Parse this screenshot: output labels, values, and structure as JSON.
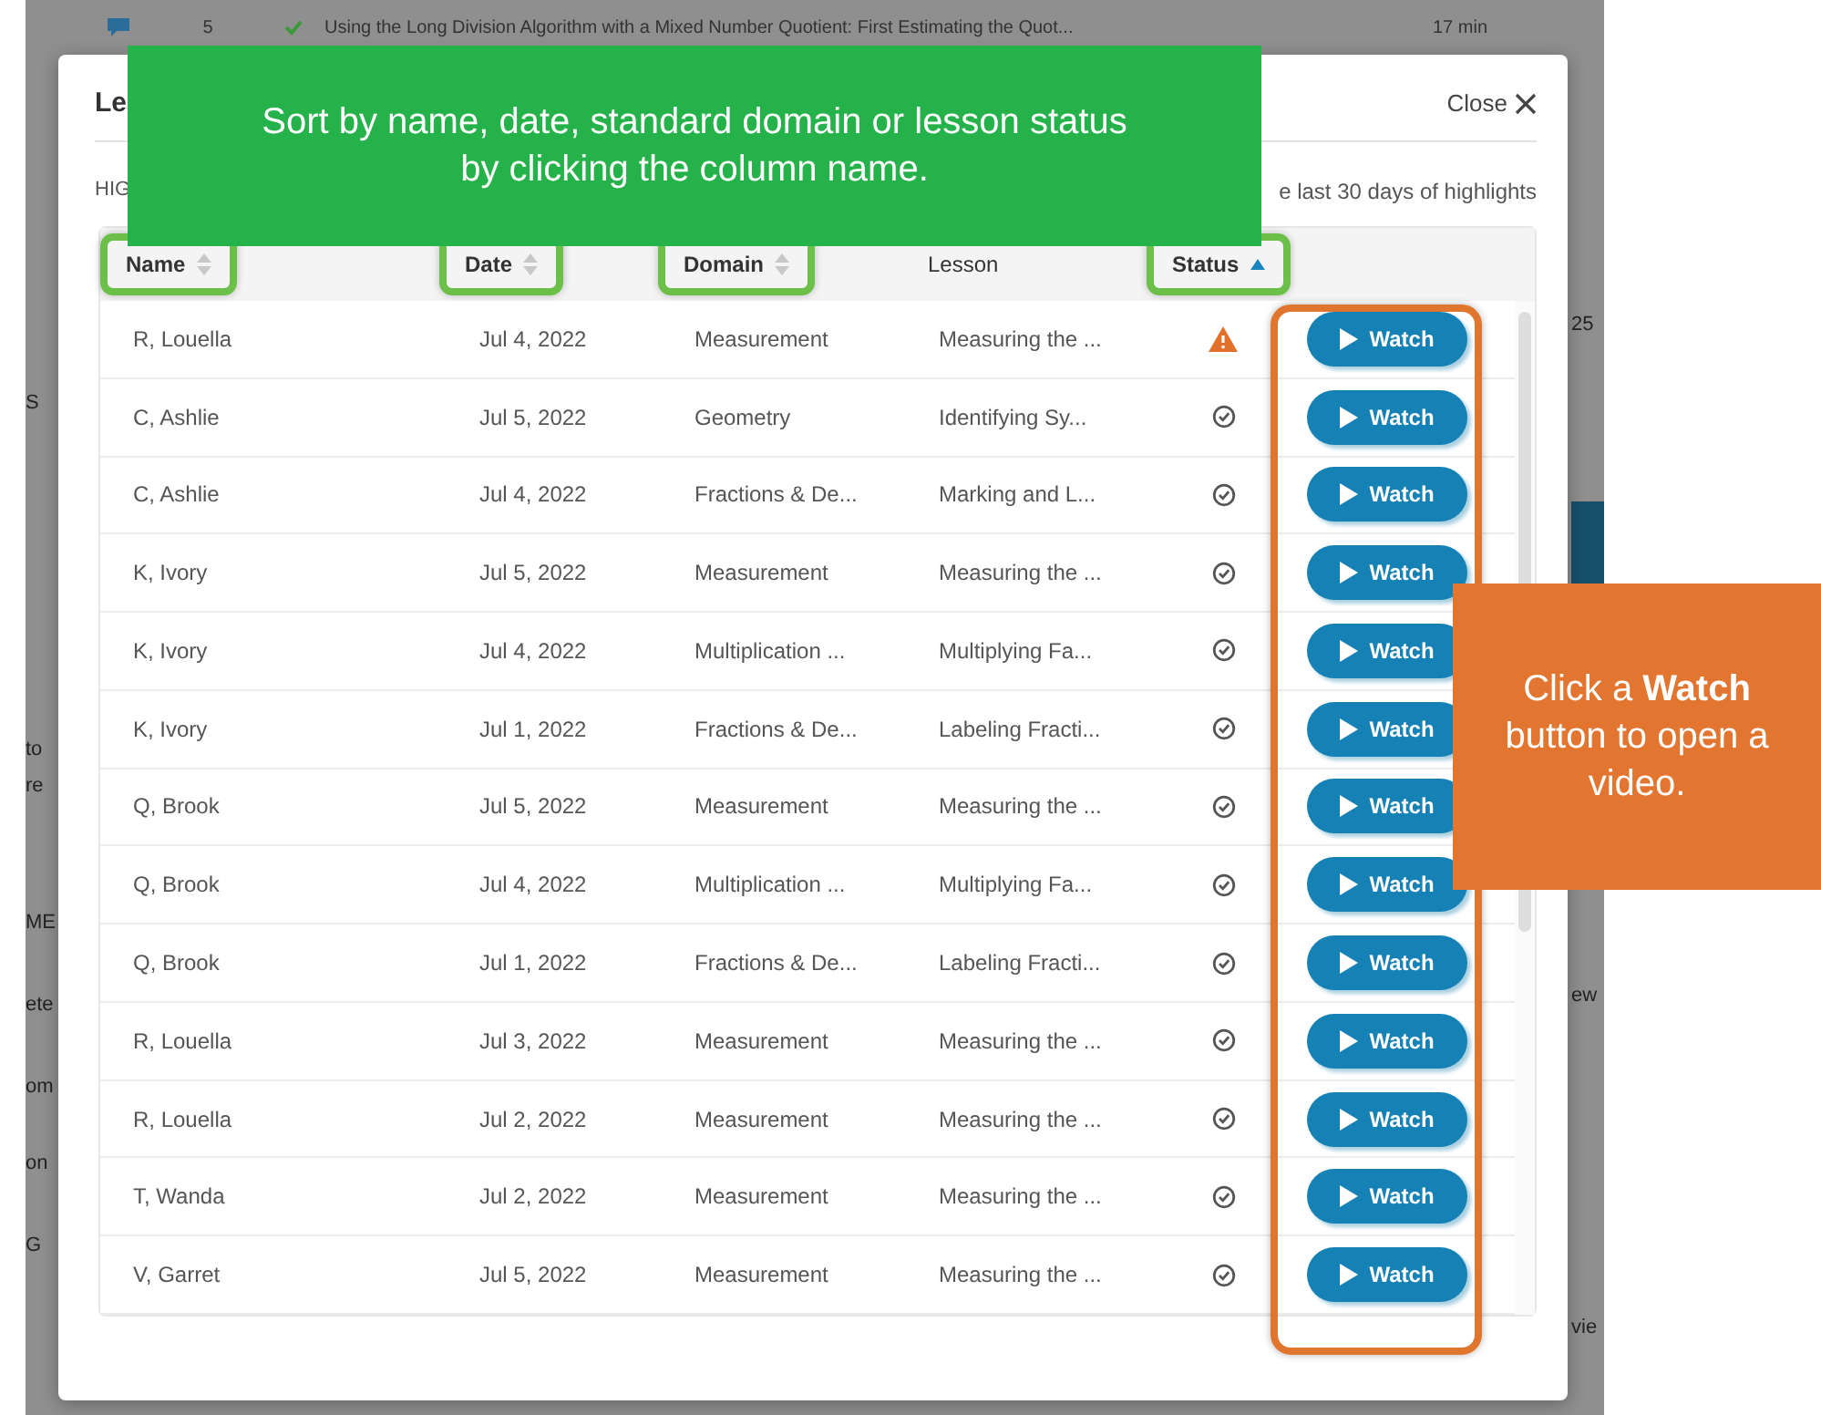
{
  "background": {
    "top_row": {
      "count": "5",
      "lesson": "Using the Long Division Algorithm with a Mixed Number Quotient: First Estimating the Quot...",
      "duration": "17 min"
    },
    "left_fragments": [
      "S",
      "to",
      "re",
      "ME",
      "ete",
      "om",
      "on",
      "G"
    ],
    "right_fragments": [
      "25",
      "ew",
      "vie"
    ]
  },
  "modal": {
    "title": "Le",
    "close_label": "Close",
    "subtitle": "HIG",
    "range_note": "e last 30 days of highlights",
    "columns": [
      {
        "label": "Name",
        "sortable": true,
        "sorted": false,
        "highlighted": true
      },
      {
        "label": "Date",
        "sortable": true,
        "sorted": false,
        "highlighted": true
      },
      {
        "label": "Domain",
        "sortable": true,
        "sorted": false,
        "highlighted": true
      },
      {
        "label": "Lesson",
        "sortable": false,
        "highlighted": false
      },
      {
        "label": "Status",
        "sortable": true,
        "sorted": true,
        "highlighted": true
      }
    ],
    "rows": [
      {
        "name": "R, Louella",
        "date": "Jul 4, 2022",
        "domain": "Measurement",
        "lesson": "Measuring the ...",
        "flagged": true,
        "action": "Watch"
      },
      {
        "name": "C, Ashlie",
        "date": "Jul 5, 2022",
        "domain": "Geometry",
        "lesson": "Identifying Sy...",
        "flagged": false,
        "action": "Watch"
      },
      {
        "name": "C, Ashlie",
        "date": "Jul 4, 2022",
        "domain": "Fractions & De...",
        "lesson": "Marking and L...",
        "flagged": false,
        "action": "Watch"
      },
      {
        "name": "K, Ivory",
        "date": "Jul 5, 2022",
        "domain": "Measurement",
        "lesson": "Measuring the ...",
        "flagged": false,
        "action": "Watch"
      },
      {
        "name": "K, Ivory",
        "date": "Jul 4, 2022",
        "domain": "Multiplication ...",
        "lesson": "Multiplying Fa...",
        "flagged": false,
        "action": "Watch"
      },
      {
        "name": "K, Ivory",
        "date": "Jul 1, 2022",
        "domain": "Fractions & De...",
        "lesson": "Labeling Fracti...",
        "flagged": false,
        "action": "Watch"
      },
      {
        "name": "Q, Brook",
        "date": "Jul 5, 2022",
        "domain": "Measurement",
        "lesson": "Measuring the ...",
        "flagged": false,
        "action": "Watch"
      },
      {
        "name": "Q, Brook",
        "date": "Jul 4, 2022",
        "domain": "Multiplication ...",
        "lesson": "Multiplying Fa...",
        "flagged": false,
        "action": "Watch"
      },
      {
        "name": "Q, Brook",
        "date": "Jul 1, 2022",
        "domain": "Fractions & De...",
        "lesson": "Labeling Fracti...",
        "flagged": false,
        "action": "Watch"
      },
      {
        "name": "R, Louella",
        "date": "Jul 3, 2022",
        "domain": "Measurement",
        "lesson": "Measuring the ...",
        "flagged": false,
        "action": "Watch"
      },
      {
        "name": "R, Louella",
        "date": "Jul 2, 2022",
        "domain": "Measurement",
        "lesson": "Measuring the ...",
        "flagged": false,
        "action": "Watch"
      },
      {
        "name": "T, Wanda",
        "date": "Jul 2, 2022",
        "domain": "Measurement",
        "lesson": "Measuring the ...",
        "flagged": false,
        "action": "Watch"
      },
      {
        "name": "V, Garret",
        "date": "Jul 5, 2022",
        "domain": "Measurement",
        "lesson": "Measuring the ...",
        "flagged": false,
        "action": "Watch"
      }
    ]
  },
  "callouts": [
    {
      "kind": "sort",
      "text": "Sort by name, date, standard domain or lesson status by clicking the column name."
    },
    {
      "kind": "watch",
      "text": "Click a **Watch** button to open a video."
    }
  ]
}
